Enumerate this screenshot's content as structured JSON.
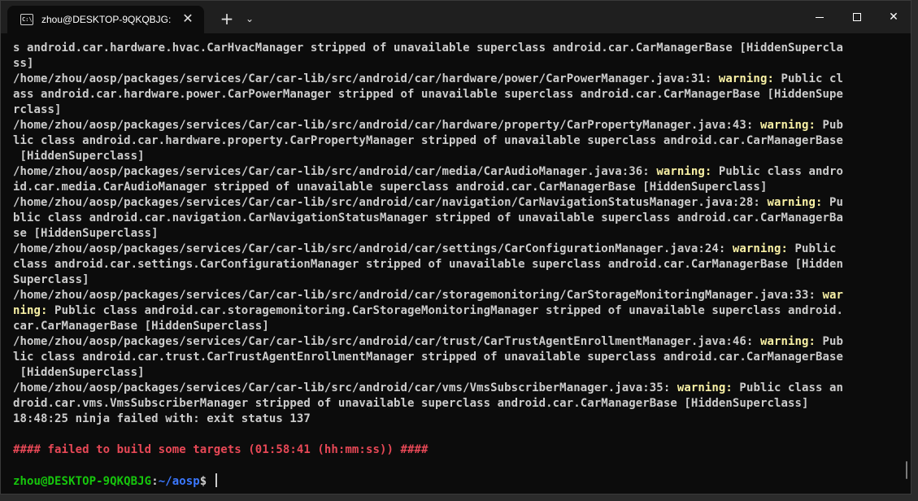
{
  "window": {
    "tab_title": "zhou@DESKTOP-9QKQBJG: ~",
    "tab_icon": "terminal-icon",
    "close_tab_glyph": "✕",
    "new_tab_glyph": "+",
    "dropdown_glyph": "⌄",
    "close_glyph": "✕"
  },
  "terminal": {
    "lines": [
      [
        {
          "t": "s android.car.hardware.hvac.CarHvacManager stripped of unavailable superclass android.car.CarManagerBase [HiddenSupercla"
        }
      ],
      [
        {
          "t": "ss]"
        }
      ],
      [
        {
          "t": "/home/zhou/aosp/packages/services/Car/car-lib/src/android/car/hardware/power/CarPowerManager.java:31: "
        },
        {
          "t": "warning:",
          "c": "warn"
        },
        {
          "t": " Public cl"
        }
      ],
      [
        {
          "t": "ass android.car.hardware.power.CarPowerManager stripped of unavailable superclass android.car.CarManagerBase [HiddenSupe"
        }
      ],
      [
        {
          "t": "rclass]"
        }
      ],
      [
        {
          "t": "/home/zhou/aosp/packages/services/Car/car-lib/src/android/car/hardware/property/CarPropertyManager.java:43: "
        },
        {
          "t": "warning:",
          "c": "warn"
        },
        {
          "t": " Pub"
        }
      ],
      [
        {
          "t": "lic class android.car.hardware.property.CarPropertyManager stripped of unavailable superclass android.car.CarManagerBase"
        }
      ],
      [
        {
          "t": " [HiddenSuperclass]"
        }
      ],
      [
        {
          "t": "/home/zhou/aosp/packages/services/Car/car-lib/src/android/car/media/CarAudioManager.java:36: "
        },
        {
          "t": "warning:",
          "c": "warn"
        },
        {
          "t": " Public class andro"
        }
      ],
      [
        {
          "t": "id.car.media.CarAudioManager stripped of unavailable superclass android.car.CarManagerBase [HiddenSuperclass]"
        }
      ],
      [
        {
          "t": "/home/zhou/aosp/packages/services/Car/car-lib/src/android/car/navigation/CarNavigationStatusManager.java:28: "
        },
        {
          "t": "warning:",
          "c": "warn"
        },
        {
          "t": " Pu"
        }
      ],
      [
        {
          "t": "blic class android.car.navigation.CarNavigationStatusManager stripped of unavailable superclass android.car.CarManagerBa"
        }
      ],
      [
        {
          "t": "se [HiddenSuperclass]"
        }
      ],
      [
        {
          "t": "/home/zhou/aosp/packages/services/Car/car-lib/src/android/car/settings/CarConfigurationManager.java:24: "
        },
        {
          "t": "warning:",
          "c": "warn"
        },
        {
          "t": " Public"
        }
      ],
      [
        {
          "t": "class android.car.settings.CarConfigurationManager stripped of unavailable superclass android.car.CarManagerBase [Hidden"
        }
      ],
      [
        {
          "t": "Superclass]"
        }
      ],
      [
        {
          "t": "/home/zhou/aosp/packages/services/Car/car-lib/src/android/car/storagemonitoring/CarStorageMonitoringManager.java:33: "
        },
        {
          "t": "war",
          "c": "warn"
        }
      ],
      [
        {
          "t": "ning:",
          "c": "warn"
        },
        {
          "t": " Public class android.car.storagemonitoring.CarStorageMonitoringManager stripped of unavailable superclass android."
        }
      ],
      [
        {
          "t": "car.CarManagerBase [HiddenSuperclass]"
        }
      ],
      [
        {
          "t": "/home/zhou/aosp/packages/services/Car/car-lib/src/android/car/trust/CarTrustAgentEnrollmentManager.java:46: "
        },
        {
          "t": "warning:",
          "c": "warn"
        },
        {
          "t": " Pub"
        }
      ],
      [
        {
          "t": "lic class android.car.trust.CarTrustAgentEnrollmentManager stripped of unavailable superclass android.car.CarManagerBase"
        }
      ],
      [
        {
          "t": " [HiddenSuperclass]"
        }
      ],
      [
        {
          "t": "/home/zhou/aosp/packages/services/Car/car-lib/src/android/car/vms/VmsSubscriberManager.java:35: "
        },
        {
          "t": "warning:",
          "c": "warn"
        },
        {
          "t": " Public class an"
        }
      ],
      [
        {
          "t": "droid.car.vms.VmsSubscriberManager stripped of unavailable superclass android.car.CarManagerBase [HiddenSuperclass]"
        }
      ],
      [
        {
          "t": "18:48:25 ninja failed with: exit status 137"
        }
      ],
      [
        {
          "t": ""
        }
      ],
      [
        {
          "t": "#### failed to build some targets (01:58:41 (hh:mm:ss)) ####",
          "c": "err"
        }
      ],
      [
        {
          "t": ""
        }
      ]
    ],
    "prompt": {
      "user_host": "zhou@DESKTOP-9QKQBJG",
      "sep": ":",
      "path": "~/aosp",
      "symbol": "$ "
    }
  },
  "colors": {
    "background": "#0c0c0c",
    "text": "#cccccc",
    "warning": "#f9f1a5",
    "error": "#e74856",
    "prompt_user": "#16c60c",
    "prompt_path": "#3b78ff"
  }
}
